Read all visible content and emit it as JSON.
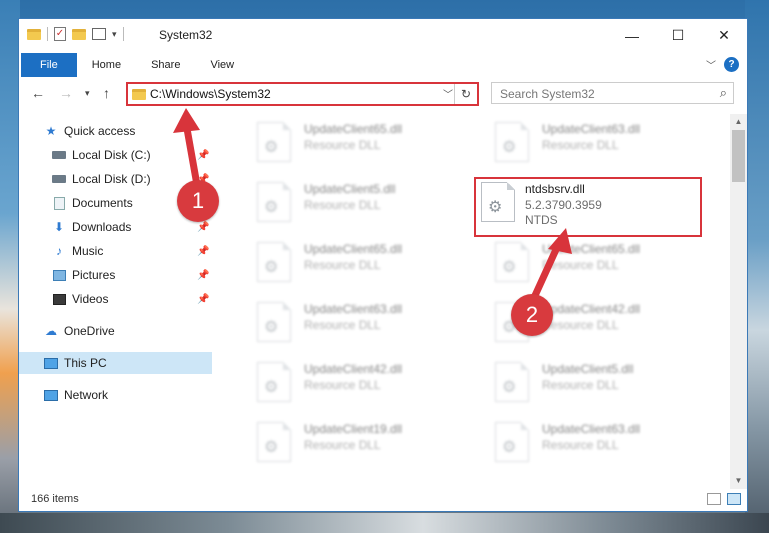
{
  "window": {
    "title": "System32"
  },
  "ribbon": {
    "tabs": [
      "File",
      "Home",
      "Share",
      "View"
    ],
    "help": "?"
  },
  "address": {
    "path": "C:\\Windows\\System32"
  },
  "search": {
    "placeholder": "Search System32"
  },
  "nav": {
    "items": [
      {
        "label": "Quick access",
        "icon": "star-icon"
      },
      {
        "label": "Local Disk (C:)",
        "icon": "drive-icon",
        "pinned": true
      },
      {
        "label": "Local Disk (D:)",
        "icon": "drive-icon",
        "pinned": true
      },
      {
        "label": "Documents",
        "icon": "document-icon",
        "pinned": true
      },
      {
        "label": "Downloads",
        "icon": "download-icon",
        "pinned": true
      },
      {
        "label": "Music",
        "icon": "music-icon",
        "pinned": true
      },
      {
        "label": "Pictures",
        "icon": "picture-icon",
        "pinned": true
      },
      {
        "label": "Videos",
        "icon": "video-icon",
        "pinned": true
      },
      {
        "label": "OneDrive",
        "icon": "cloud-icon"
      },
      {
        "label": "This PC",
        "icon": "computer-icon",
        "selected": true
      },
      {
        "label": "Network",
        "icon": "network-icon"
      }
    ]
  },
  "files": {
    "left": [
      {
        "name": "UpdateClient65.dll",
        "type": "Resource DLL"
      },
      {
        "name": "UpdateClient5.dll",
        "type": "Resource DLL"
      },
      {
        "name": "UpdateClient65.dll",
        "type": "Resource DLL"
      },
      {
        "name": "UpdateClient63.dll",
        "type": "Resource DLL"
      },
      {
        "name": "UpdateClient42.dll",
        "type": "Resource DLL"
      },
      {
        "name": "UpdateClient19.dll",
        "type": "Resource DLL"
      }
    ],
    "right": [
      {
        "name": "UpdateClient63.dll",
        "type": "Resource DLL"
      },
      {
        "name": "ntdsbsrv.dll",
        "version": "5.2.3790.3959",
        "company": "NTDS",
        "highlighted": true
      },
      {
        "name": "UpdateClient65.dll",
        "type": "Resource DLL"
      },
      {
        "name": "UpdateClient42.dll",
        "type": "Resource DLL"
      },
      {
        "name": "UpdateClient5.dll",
        "type": "Resource DLL"
      },
      {
        "name": "UpdateClient63.dll",
        "type": "Resource DLL"
      }
    ]
  },
  "status": {
    "item_count": "166 items"
  },
  "annotations": {
    "marker1": "1",
    "marker2": "2",
    "color": "#d8343b"
  }
}
